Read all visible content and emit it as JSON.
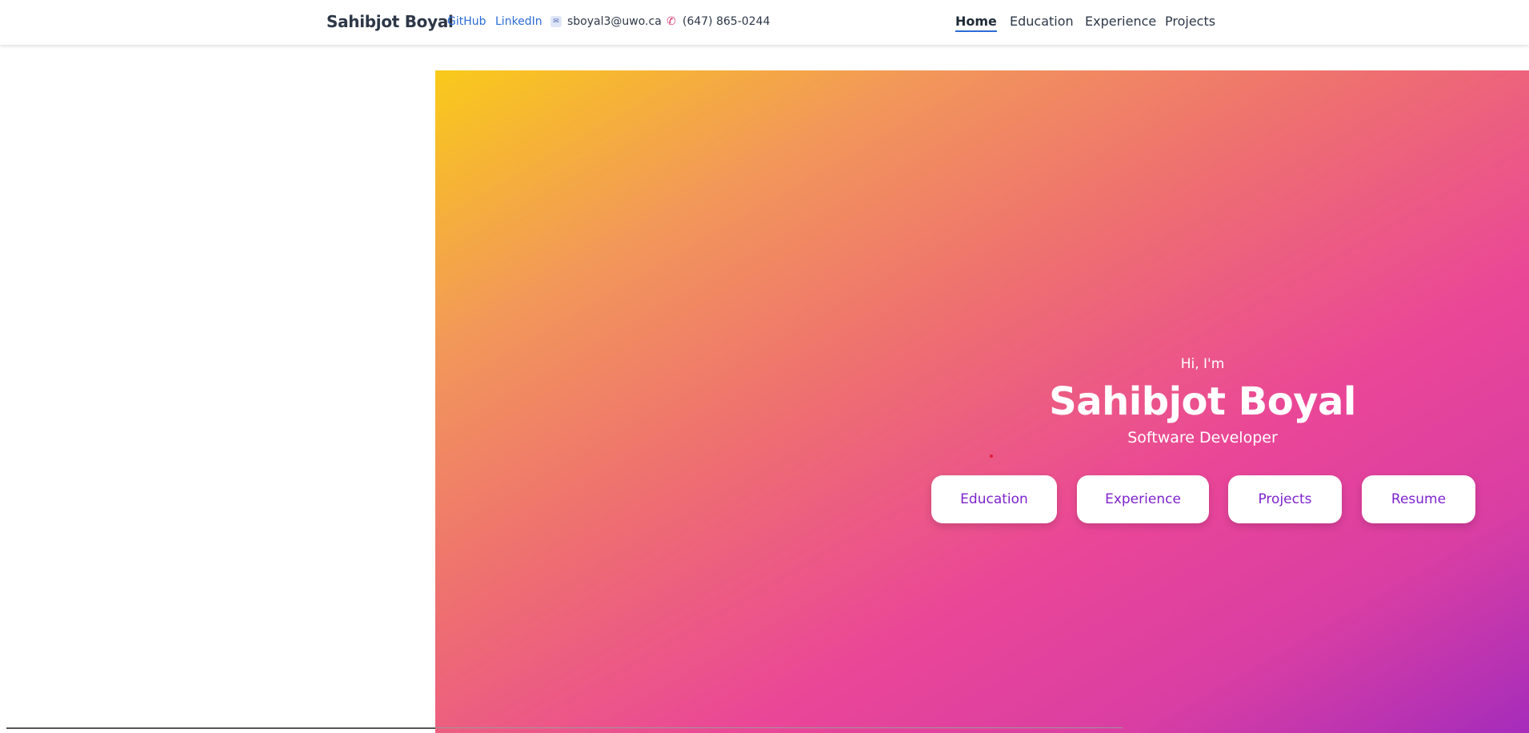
{
  "header": {
    "brand": "Sahibjot Boyal",
    "links": {
      "github": "GitHub",
      "linkedin": "LinkedIn"
    },
    "email": "sboyal3@uwo.ca",
    "phone": "(647) 865-0244",
    "nav": {
      "home": "Home",
      "education": "Education",
      "experience": "Experience",
      "projects": "Projects"
    },
    "active_nav": "Home",
    "icons": {
      "email": "email-icon",
      "phone": "phone-icon"
    }
  },
  "hero": {
    "greeting": "Hi, I'm",
    "name": "Sahibjot Boyal",
    "title": "Software Developer",
    "buttons": {
      "education": "Education",
      "experience": "Experience",
      "projects": "Projects",
      "resume": "Resume"
    },
    "gradient_colors": [
      "#f9ca1a",
      "#f2975a",
      "#ee6f70",
      "#ea4698",
      "#d93ea3",
      "#a52cbb"
    ],
    "button_text_color": "#7e22ce"
  }
}
